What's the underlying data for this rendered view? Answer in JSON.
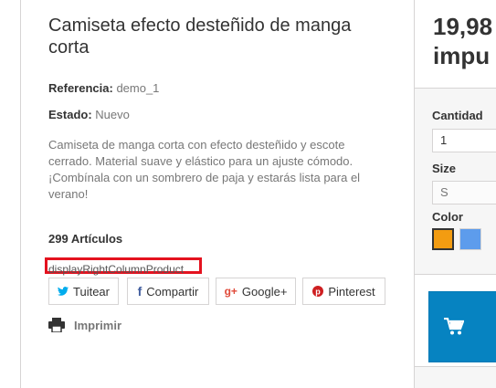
{
  "product": {
    "title": "Camiseta efecto desteñido de manga corta",
    "reference_label": "Referencia:",
    "reference_value": "demo_1",
    "condition_label": "Estado:",
    "condition_value": "Nuevo",
    "description": "Camiseta de manga corta con efecto desteñido y escote cerrado. Material suave y elástico para un ajuste cómodo. ¡Combínala con un sombrero de paja y estarás lista para el verano!",
    "quantity_available": "299 Artículos",
    "hook_label": "displayRightColumnProduct"
  },
  "social": {
    "twitter": "Tuitear",
    "facebook": "Compartir",
    "google": "Google+",
    "pinterest": "Pinterest"
  },
  "print": {
    "label": "Imprimir"
  },
  "buy_box": {
    "price": "19,98",
    "tax_note": "impu",
    "quantity_label": "Cantidad",
    "quantity_value": "1",
    "size_label": "Size",
    "size_value": "S",
    "color_label": "Color",
    "colors": [
      "#f39c11",
      "#5d9cec"
    ]
  },
  "theme": {
    "accent": "#0683c1",
    "highlight": "#e4121f"
  }
}
